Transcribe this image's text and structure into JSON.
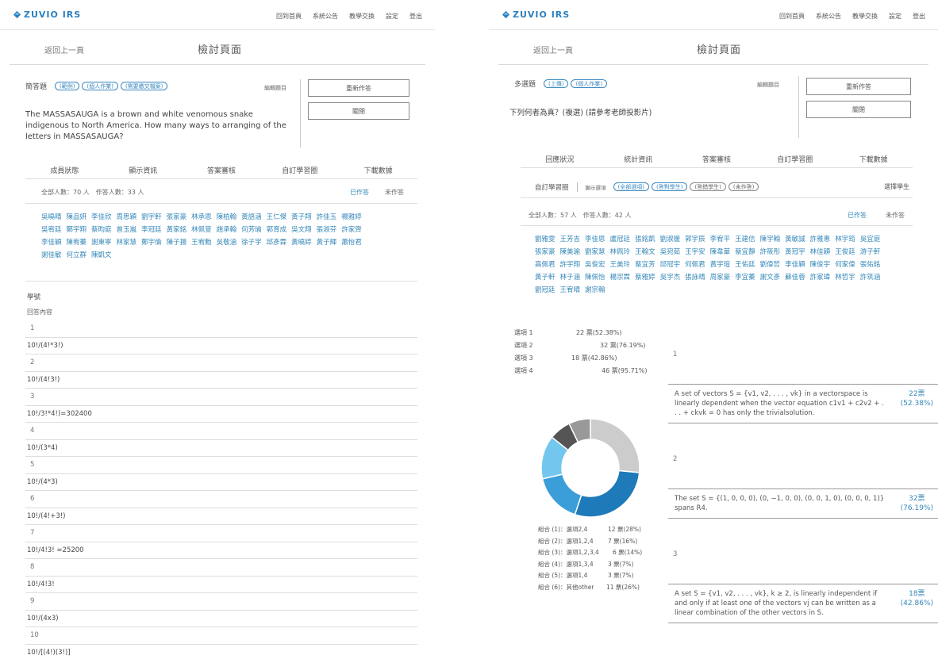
{
  "brand": {
    "name": "ZUVIO IRS",
    "color": "#2c7fc0"
  },
  "left": {
    "nav": [
      "回到首頁",
      "系統公告",
      "教學交換",
      "設定",
      "登出"
    ],
    "back": "返回上一頁",
    "title": "檢討頁面",
    "qtype": "簡答題",
    "tags": [
      "(範例)",
      "(個人作業)",
      "(需要繳交檔案)"
    ],
    "edit_label": "編輯題目",
    "btn_resend": "重新作答",
    "btn_close": "關閉",
    "question": "The MASSASAUGA is a brown and white venomous snake indigenous to North America. How many ways to arranging of the letters in MASSASAUGA?",
    "tabs": [
      "成員狀態",
      "顯示資訊",
      "答案審核",
      "自訂學習圈",
      "下載數據"
    ],
    "stats": "全部人數：70 人　作答人數：33 人",
    "link_answered": "已作答",
    "link_unanswered": "未作答",
    "names": [
      "吳曉晴",
      "陳品妍",
      "李佳欣",
      "周思穎",
      "劉宇軒",
      "張家豪",
      "林承恩",
      "陳柏翰",
      "黃語涵",
      "王仁傑",
      "黃子翔",
      "許佳玉",
      "楊雅婷",
      "吳宥廷",
      "鄭宇翔",
      "蔡昀庭",
      "曾玉嵐",
      "李冠廷",
      "黃家銘",
      "林佩萱",
      "趙承翰",
      "何芳瑜",
      "郭育成",
      "吳文翔",
      "張淑芬",
      "許家齊",
      "李佳穎",
      "陳宥蓁",
      "謝東寧",
      "林家慧",
      "鄭宇倫",
      "陳子揚",
      "王宥勳",
      "吳敬涵",
      "徐子宇",
      "邱彥霖",
      "黃曉婷",
      "黃子輝",
      "蕭怡君",
      "謝佳敏",
      "何立群",
      "陳凱文"
    ],
    "answer_header": "學號",
    "answer_sub": "回答內容",
    "answers": [
      {
        "n": "1",
        "a": "10!/(4!*3!)"
      },
      {
        "n": "2",
        "a": "10!/(4!3!)"
      },
      {
        "n": "3",
        "a": "10!/3!*4!)=302400"
      },
      {
        "n": "4",
        "a": "10!/(3*4)"
      },
      {
        "n": "5",
        "a": "10!/(4*3)"
      },
      {
        "n": "6",
        "a": "10!/(4!+3!)"
      },
      {
        "n": "7",
        "a": "10!/4!3! =25200"
      },
      {
        "n": "8",
        "a": "10!/4!3!"
      },
      {
        "n": "9",
        "a": "10!/(4x3)"
      },
      {
        "n": "10",
        "a": "10!/[(4!)(3!)]"
      }
    ]
  },
  "right": {
    "nav": [
      "回到首頁",
      "系統公告",
      "教學交換",
      "設定",
      "登出"
    ],
    "back": "返回上一頁",
    "title": "檢討頁面",
    "qtype": "多選題",
    "tags": [
      "(上傳)",
      "(個人作業)"
    ],
    "edit_label": "編輯題目",
    "btn_resend": "重新作答",
    "btn_close": "關閉",
    "question": "下列何者為真？(複選) (請參考老師投影片)",
    "tabs": [
      "回應狀況",
      "統計資訊",
      "答案審核",
      "自訂學習圈",
      "下載數據"
    ],
    "filter_label": "自訂學習圈",
    "filter_small": "顯示選項",
    "filter_chips": [
      "(全部選項)",
      "(答對學生)",
      "(答錯學生)",
      "(未作答)"
    ],
    "filter_right": "選擇學生",
    "stats": "全部人數：57 人　作答人數：42 人",
    "link_answered": "已作答",
    "link_unanswered": "未作答",
    "names": [
      "劉雅雯",
      "王芳吉",
      "李佳恩",
      "盧冠廷",
      "張銘凱",
      "劉淑媛",
      "郭宇辰",
      "李宥平",
      "王建信",
      "陳宇翰",
      "黃敏誠",
      "許雅惠",
      "林宇筠",
      "吳宜庭",
      "張家豪",
      "陳美瑜",
      "劉家慧",
      "林佩玲",
      "王翰文",
      "吳宛茹",
      "王宇安",
      "陳韋華",
      "蔡宜靜",
      "許筱彤",
      "黃冠宇",
      "林佳穎",
      "王俊廷",
      "游子軒",
      "高佩君",
      "許宇翔",
      "吳俊宏",
      "王美玲",
      "蔡宜芳",
      "邱冠宇",
      "何佩君",
      "黃宇瑄",
      "王佑廷",
      "劉偉哲",
      "李佳穎",
      "陳俊宇",
      "何家偉",
      "張佑銘",
      "黃子軒",
      "林子涵",
      "陳佩怡",
      "楊宗霖",
      "蔡雅婷",
      "吳宇杰",
      "張詠晴",
      "周家豪",
      "李宜蓁",
      "謝文彥",
      "蘇佳蓉",
      "許家瑋",
      "林哲宇",
      "許筑涵",
      "劉冠廷",
      "王宥晴",
      "謝宗翰"
    ],
    "choice_stats": [
      {
        "label": "選項 1",
        "votes": "22 票(52.38%)"
      },
      {
        "label": "選項 2",
        "votes": "32 票(76.19%)"
      },
      {
        "label": "選項 3",
        "votes": "18 票(42.86%)"
      },
      {
        "label": "選項 4",
        "votes": "46 票(95.71%)"
      }
    ],
    "donut_legend": [
      {
        "label": "組合 (1)：選項2,4",
        "votes": "12 票(28%)",
        "value": 28,
        "color": "#1e7ab8"
      },
      {
        "label": "組合 (2)：選項1,2,4",
        "votes": "7 票(16%)",
        "value": 16,
        "color": "#3b9ed9"
      },
      {
        "label": "組合 (3)：選項1,2,3,4",
        "votes": "6 票(14%)",
        "value": 14,
        "color": "#73c7ee"
      },
      {
        "label": "組合 (4)：選項1,3,4",
        "votes": "3 票(7%)",
        "value": 7,
        "color": "#555555"
      },
      {
        "label": "組合 (5)：選項1,4",
        "votes": "3 票(7%)",
        "value": 7,
        "color": "#999999"
      },
      {
        "label": "組合 (6)：其他other",
        "votes": "11 票(26%)",
        "value": 26,
        "color": "#cccccc"
      }
    ],
    "options": [
      {
        "num": "1",
        "text": "A set of vectors S = {v1, v2, . . . , vk} in a vectorspace is linearly dependent when the vector equation c1v1 + c2v2 + . . . + ckvk = 0 has only the trivialsolution.",
        "pct1": "22票",
        "pct2": "(52.38%)"
      },
      {
        "num": "2",
        "text": "The set S = {(1, 0, 0, 0), (0, −1, 0, 0), (0, 0, 1, 0), (0, 0, 0, 1)} spans R4.",
        "pct1": "32票",
        "pct2": "(76.19%)"
      },
      {
        "num": "3",
        "text": "A set S = {v1, v2, . . . , vk}, k ≥ 2, is linearly independent if and only if at least one of the vectors vj can be written as a linear combination of the other vectors in S.",
        "pct1": "18票",
        "pct2": "(42.86%)"
      }
    ]
  }
}
